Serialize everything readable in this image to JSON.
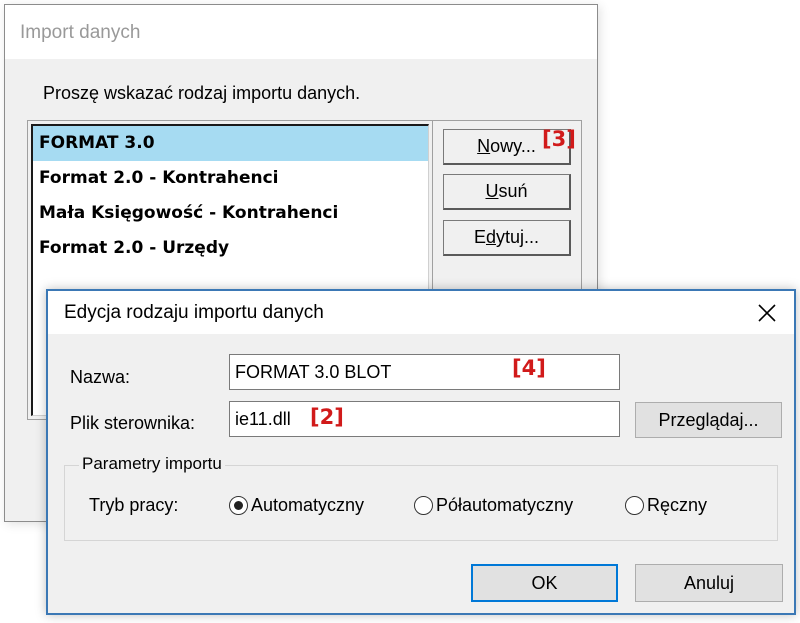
{
  "background_dialog": {
    "title": "Import danych",
    "prompt": "Proszę wskazać rodzaj importu danych.",
    "list_items": [
      {
        "label": "FORMAT 3.0",
        "selected": true
      },
      {
        "label": "Format 2.0 - Kontrahenci",
        "selected": false
      },
      {
        "label": "Mała Księgowość - Kontrahenci",
        "selected": false
      },
      {
        "label": "Format 2.0 - Urzędy",
        "selected": false
      }
    ],
    "buttons": {
      "new": {
        "accel": "N",
        "rest": "owy..."
      },
      "delete": {
        "accel": "U",
        "rest": "suń"
      },
      "edit": {
        "pre": "E",
        "accel": "d",
        "rest": "ytuj..."
      }
    },
    "annotation_new": "[3]"
  },
  "edit_dialog": {
    "title": "Edycja rodzaju importu danych",
    "close_icon": "close-icon",
    "name_label": "Nazwa:",
    "name_value": "FORMAT 3.0 BLOT",
    "name_annotation": "[4]",
    "driver_label": "Plik sterownika:",
    "driver_value": "ie11.dll",
    "driver_annotation": "[2]",
    "browse_button": "Przeglądaj...",
    "group_title": "Parametry importu",
    "mode_label": "Tryb pracy:",
    "modes": [
      {
        "label": "Automatyczny",
        "checked": true
      },
      {
        "label": "Półautomatyczny",
        "checked": false
      },
      {
        "label": "Ręczny",
        "checked": false
      }
    ],
    "ok_button": "OK",
    "cancel_button": "Anuluj"
  },
  "colors": {
    "selection": "#a6dbf2",
    "annotation": "#d11a1a",
    "dialog_border": "#3b78b5",
    "default_button_border": "#0078d7"
  }
}
